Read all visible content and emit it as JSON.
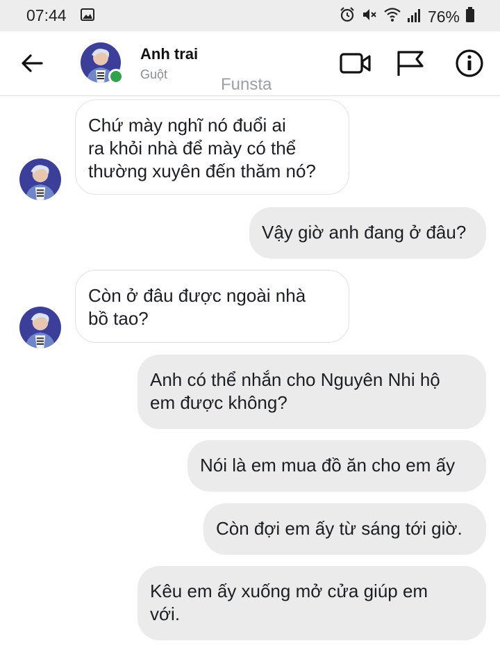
{
  "status": {
    "time": "07:44",
    "battery": "76%"
  },
  "header": {
    "contact_name": "Anh trai",
    "contact_subtitle": "Guột",
    "watermark": "Funsta"
  },
  "messages": [
    {
      "side": "in",
      "text": "Chứ mày nghĩ nó đuổi ai\nra khỏi nhà để mày có thể\nthường xuyên đến thăm nó?"
    },
    {
      "side": "out",
      "text": "Vậy giờ anh đang ở đâu?"
    },
    {
      "side": "in",
      "text": "Còn ở đâu được ngoài nhà\nbồ tao?"
    },
    {
      "side": "out",
      "text": "Anh có thể nhắn cho Nguyên Nhi hộ\nem được không?"
    },
    {
      "side": "out",
      "text": "Nói là em mua đồ ăn cho em ấy"
    },
    {
      "side": "out",
      "text": "Còn đợi em ấy từ sáng tới giờ."
    },
    {
      "side": "out",
      "text": "Kêu em ấy xuống mở cửa giúp em\nvới."
    }
  ],
  "colors": {
    "online": "#31a24c",
    "outgoing_bubble": "#ebebeb",
    "incoming_bubble": "#ffffff"
  }
}
